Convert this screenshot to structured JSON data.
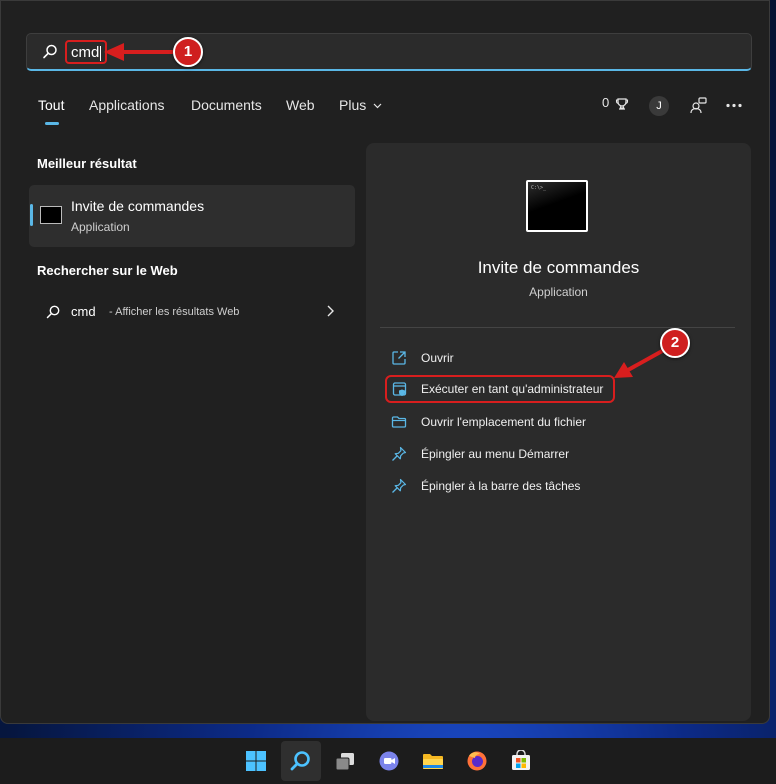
{
  "search": {
    "query": "cmd"
  },
  "annotations": {
    "step1": "1",
    "step2": "2"
  },
  "tabs": [
    {
      "label": "Tout"
    },
    {
      "label": "Applications"
    },
    {
      "label": "Documents"
    },
    {
      "label": "Web"
    },
    {
      "label": "Plus"
    }
  ],
  "header_right": {
    "points": "0",
    "avatar_letter": "J"
  },
  "best_match": {
    "title": "Meilleur résultat",
    "name": "Invite de commandes",
    "type": "Application"
  },
  "web_search": {
    "title": "Rechercher sur le Web",
    "query": "cmd",
    "description": " - Afficher les résultats Web"
  },
  "details": {
    "name": "Invite de commandes",
    "type": "Application",
    "icon_text": "C:\\>_",
    "actions": [
      {
        "label": "Ouvrir",
        "icon": "open-external-icon"
      },
      {
        "label": "Exécuter en tant qu'administrateur",
        "icon": "run-as-admin-icon"
      },
      {
        "label": "Ouvrir l'emplacement du fichier",
        "icon": "folder-icon"
      },
      {
        "label": "Épingler au menu Démarrer",
        "icon": "pin-icon"
      },
      {
        "label": "Épingler à la barre des tâches",
        "icon": "pin-icon"
      }
    ]
  },
  "colors": {
    "accent": "#5ab7e6",
    "annotation_red": "#d81e1e",
    "panel_bg": "#202020",
    "detail_bg": "#2b2b2b"
  },
  "taskbar": {
    "icons": [
      "windows-start-icon",
      "search-icon",
      "task-view-icon",
      "teams-chat-icon",
      "file-explorer-icon",
      "firefox-icon",
      "microsoft-store-icon"
    ],
    "active": "search-icon"
  }
}
